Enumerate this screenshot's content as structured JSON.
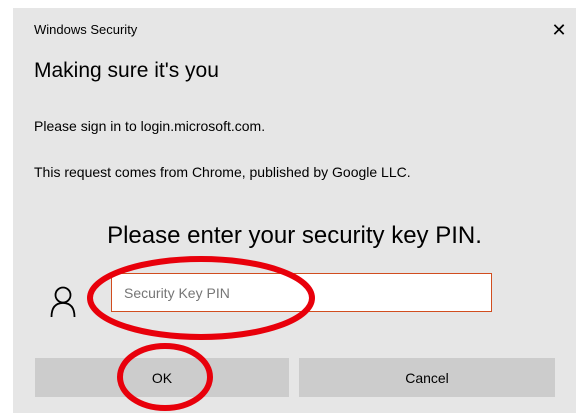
{
  "window": {
    "title": "Windows Security",
    "close_symbol": "✕"
  },
  "dialog": {
    "heading": "Making sure it's you",
    "sign_in_text": "Please sign in to login.microsoft.com.",
    "request_text": "This request comes from Chrome, published by Google LLC.",
    "pin_prompt": "Please enter your security key PIN."
  },
  "pin_field": {
    "placeholder": "Security Key PIN",
    "value": "",
    "icon": "user-icon"
  },
  "buttons": {
    "ok_label": "OK",
    "cancel_label": "Cancel"
  },
  "colors": {
    "dialog_background": "#e6e6e6",
    "button_background": "#cccccc",
    "input_border": "#d14d1f",
    "annotation_red": "#e8000b"
  }
}
